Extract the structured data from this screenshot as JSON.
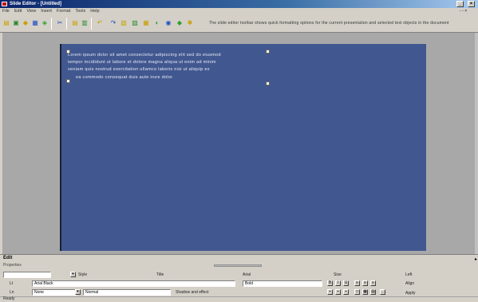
{
  "window": {
    "title": "Slide Editor - [Untitled]",
    "minimize_label": "_",
    "close_label": "×"
  },
  "menu": {
    "items": [
      "File",
      "Edit",
      "View",
      "Insert",
      "Format",
      "Tools",
      "Help"
    ],
    "right_label": "- ▫ ×"
  },
  "toolbar": {
    "status_text": "The slide editor toolbar shows quick formatting options for the current presentation and selected text objects in the document"
  },
  "slide": {
    "lines": [
      "Lorem ipsum dolor sit amet consectetur adipiscing elit sed do eiusmod",
      "tempor incididunt ut labore et dolore magna aliqua ut enim ad minim",
      "veniam quis nostrud exercitation ullamco laboris nisi ut aliquip ex",
      "ea commodo consequat duis aute irure dolor"
    ]
  },
  "panel": {
    "title": "Edit",
    "tabs": "Properties",
    "row1": {
      "name_label": "Style",
      "text_label": "Title",
      "font_label": "Arial",
      "size_label": "Size",
      "align_label": "Left"
    },
    "row2": {
      "prefix": "Lt",
      "font_value": "Arial Black",
      "bold_label": "Bold",
      "right_label": "Align"
    },
    "row3": {
      "prefix": "Ln",
      "value_a": "None",
      "value_b": "Normal",
      "value_c": "Shadow and effect",
      "bottom_right_label": "Apply"
    }
  },
  "status": {
    "text": "Ready"
  }
}
